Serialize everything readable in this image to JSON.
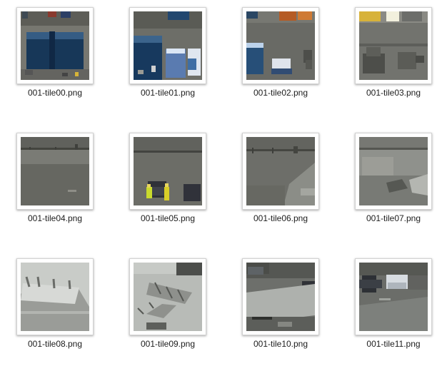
{
  "files": [
    {
      "name": "001-tile00.png",
      "thumbnail": "tile00-thumbnail"
    },
    {
      "name": "001-tile01.png",
      "thumbnail": "tile01-thumbnail"
    },
    {
      "name": "001-tile02.png",
      "thumbnail": "tile02-thumbnail"
    },
    {
      "name": "001-tile03.png",
      "thumbnail": "tile03-thumbnail"
    },
    {
      "name": "001-tile04.png",
      "thumbnail": "tile04-thumbnail"
    },
    {
      "name": "001-tile05.png",
      "thumbnail": "tile05-thumbnail"
    },
    {
      "name": "001-tile06.png",
      "thumbnail": "tile06-thumbnail"
    },
    {
      "name": "001-tile07.png",
      "thumbnail": "tile07-thumbnail"
    },
    {
      "name": "001-tile08.png",
      "thumbnail": "tile08-thumbnail"
    },
    {
      "name": "001-tile09.png",
      "thumbnail": "tile09-thumbnail"
    },
    {
      "name": "001-tile10.png",
      "thumbnail": "tile10-thumbnail"
    },
    {
      "name": "001-tile11.png",
      "thumbnail": "tile11-thumbnail"
    }
  ],
  "colors": {
    "background": "#ffffff",
    "label": "#1c1c1c",
    "frame_border": "#d2d2d2"
  }
}
